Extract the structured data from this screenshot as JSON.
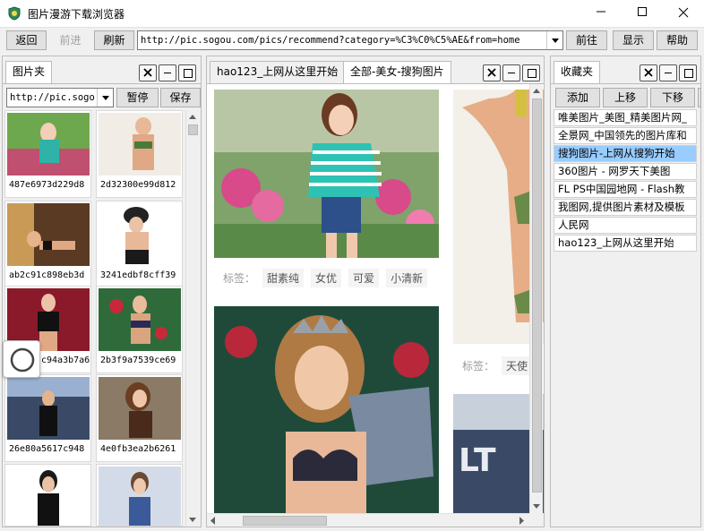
{
  "window": {
    "title": "图片漫游下载浏览器"
  },
  "toolbar": {
    "back": "返回",
    "forward": "前进",
    "refresh": "刷新",
    "url": "http://pic.sogou.com/pics/recommend?category=%C3%C0%C5%AE&from=home",
    "go": "前往",
    "show": "显示",
    "help": "帮助"
  },
  "left": {
    "tab": "图片夹",
    "combo": "http://pic.sogo",
    "pause": "暂停",
    "save": "保存",
    "thumbs": [
      {
        "id": "487e6973d229d8"
      },
      {
        "id": "2d32300e99d812"
      },
      {
        "id": "ab2c91c898eb3d"
      },
      {
        "id": "3241edbf8cff39"
      },
      {
        "id": "c94a3b7a6"
      },
      {
        "id": "2b3f9a7539ce69"
      },
      {
        "id": "26e80a5617c948"
      },
      {
        "id": "4e0fb3ea2b6261"
      },
      {
        "id": ""
      },
      {
        "id": ""
      }
    ]
  },
  "center": {
    "tabs": [
      {
        "label": "hao123_上网从这里开始"
      },
      {
        "label": "全部-美女-搜狗图片"
      }
    ],
    "card1_tags": {
      "label": "标签：",
      "items": [
        "甜素纯",
        "女优",
        "可爱",
        "小清新"
      ]
    },
    "card2_tags": {
      "label": "标签：",
      "items": [
        "天使"
      ]
    }
  },
  "right": {
    "tab": "收藏夹",
    "add": "添加",
    "up": "上移",
    "down": "下移",
    "items": [
      "唯美图片_美图_精美图片网_",
      "全景网_中国领先的图片库和",
      "搜狗图片-上网从搜狗开始",
      "360图片 - 网罗天下美图",
      "FL PS中国园地网 - Flash教",
      "我图网,提供图片素材及模板",
      "人民网",
      "hao123_上网从这里开始"
    ],
    "selected_index": 2
  },
  "colors": {
    "selection": "#99ccff",
    "border": "#bcbcbc"
  }
}
